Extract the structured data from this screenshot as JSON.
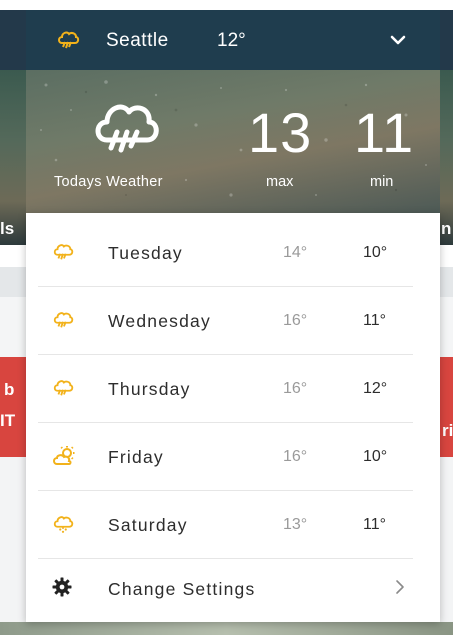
{
  "header": {
    "city": "Seattle",
    "current_temp": "12°",
    "icon": "thunderstorm-icon",
    "chevron_icon": "chevron-down-icon"
  },
  "today": {
    "label": "Todays Weather",
    "icon": "thunderstorm-icon",
    "max": "13",
    "max_label": "max",
    "min": "11",
    "min_label": "min"
  },
  "forecast": [
    {
      "day": "Tuesday",
      "high": "14°",
      "low": "10°",
      "icon": "thunderstorm-icon"
    },
    {
      "day": "Wednesday",
      "high": "16°",
      "low": "11°",
      "icon": "thunderstorm-icon"
    },
    {
      "day": "Thursday",
      "high": "16°",
      "low": "12°",
      "icon": "thunderstorm-icon"
    },
    {
      "day": "Friday",
      "high": "16°",
      "low": "10°",
      "icon": "partly-sunny-icon"
    },
    {
      "day": "Saturday",
      "high": "13°",
      "low": "11°",
      "icon": "snow-cloud-icon"
    }
  ],
  "settings": {
    "label": "Change Settings",
    "icon": "gear-icon",
    "arrow_icon": "chevron-right-icon"
  },
  "background": {
    "fragments": [
      "ls",
      "n",
      "b",
      "IT",
      "ri"
    ]
  },
  "colors": {
    "header_bg": "#1f3d4e",
    "icon_accent": "#f2b21b",
    "high_temp": "#9a9a9a",
    "red_band": "#d8453f"
  }
}
